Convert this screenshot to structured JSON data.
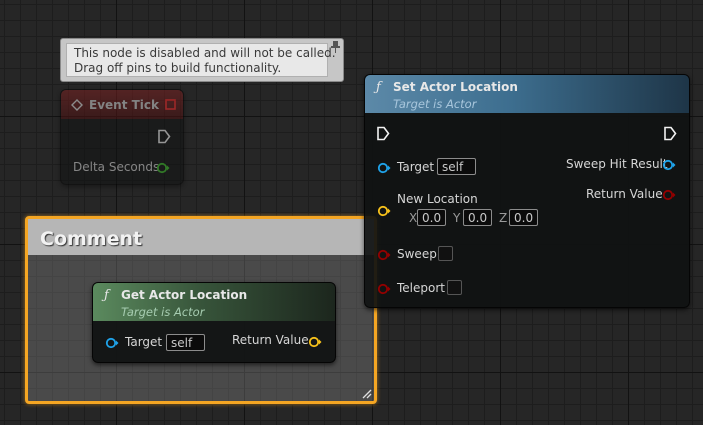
{
  "colors": {
    "comment_border": "#f5a623",
    "object_pin": "#1fa3ea",
    "vector_pin": "#f8c21b",
    "bool_pin": "#930000",
    "float_pin": "#3dbf2a",
    "set_location_header": "#3d6e8f",
    "get_location_header": "#36503a",
    "event_header": "#5a1a1a"
  },
  "tooltip": {
    "line1": "This node is disabled and will not be called.",
    "line2": "Drag off pins to build functionality.",
    "icon": "pin-icon"
  },
  "event_tick": {
    "title": "Event Tick",
    "title_icon": "event-diamond-icon",
    "delegate_icon": "delegate-square-icon",
    "exec_out_icon": "exec-out-icon",
    "delta_seconds_label": "Delta Seconds",
    "disabled": true
  },
  "comment": {
    "title": "Comment"
  },
  "get_actor_location": {
    "icon": "function-icon",
    "func_glyph": "ƒ",
    "title": "Get Actor Location",
    "subtitle": "Target is Actor",
    "target_label": "Target",
    "target_value": "self",
    "return_label": "Return Value"
  },
  "set_actor_location": {
    "icon": "function-icon",
    "func_glyph": "ƒ",
    "title": "Set Actor Location",
    "subtitle": "Target is Actor",
    "target_label": "Target",
    "target_value": "self",
    "new_location_label": "New Location",
    "x_label": "X",
    "x_value": "0.0",
    "y_label": "Y",
    "y_value": "0.0",
    "z_label": "Z",
    "z_value": "0.0",
    "sweep_hit_label": "Sweep Hit Result",
    "return_label": "Return Value",
    "sweep_label": "Sweep",
    "sweep_checked": false,
    "teleport_label": "Teleport",
    "teleport_checked": false
  }
}
